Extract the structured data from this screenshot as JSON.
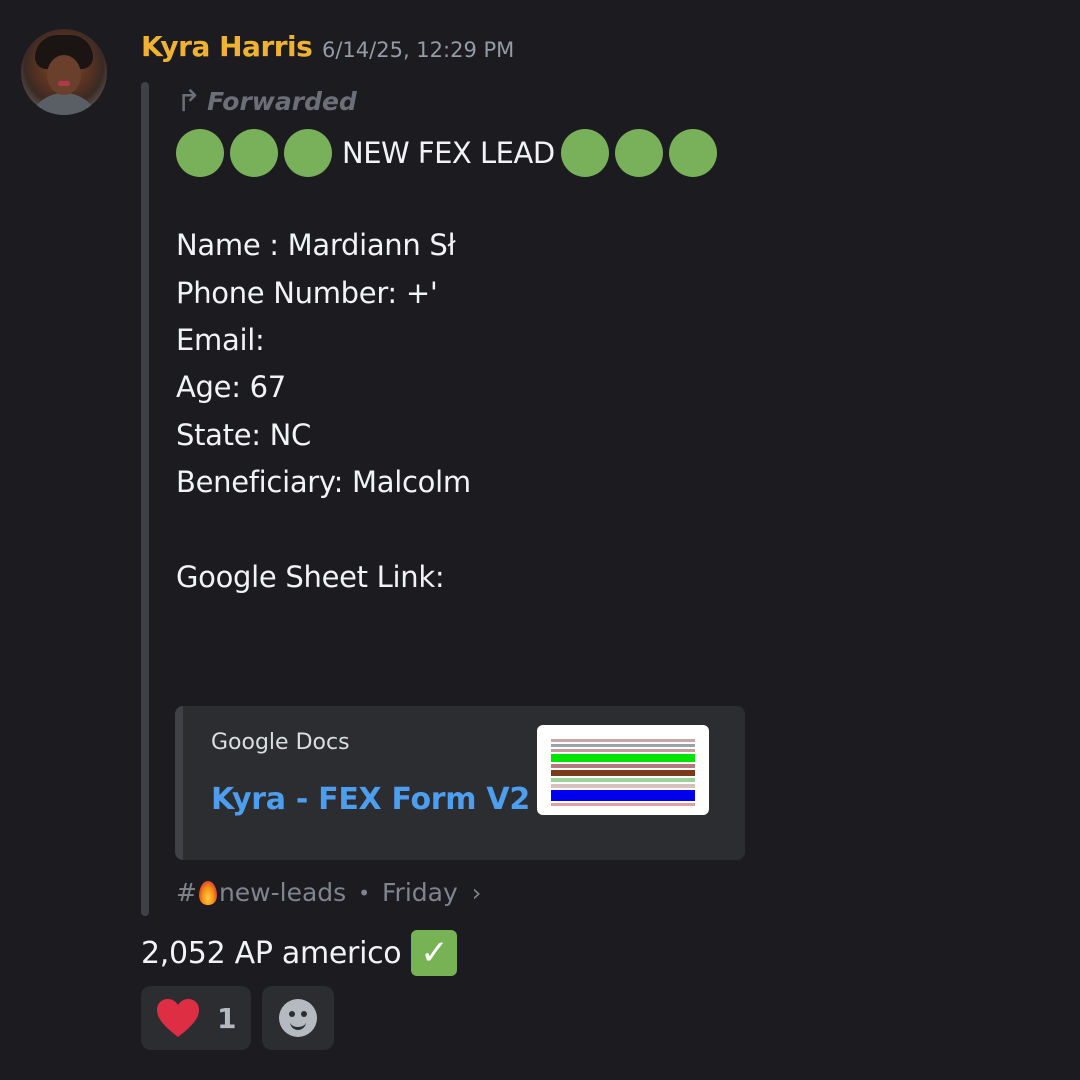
{
  "message": {
    "author": "Kyra Harris",
    "timestamp": "6/14/25, 12:29 PM",
    "forwarded_label": "Forwarded",
    "forwarded_icon": "forward-arrow-icon",
    "headline": "NEW FEX LEAD",
    "headline_emoji": "green-circle-icon",
    "fields": {
      "name": "Name : Mardiann Sł",
      "phone": "Phone Number: +'",
      "email": "Email:",
      "age": "Age: 67",
      "state": "State: NC",
      "beneficiary": "Beneficiary: Malcolm",
      "sheet_link": "Google Sheet Link:"
    },
    "embed": {
      "provider": "Google Docs",
      "title": "Kyra - FEX Form V2"
    },
    "source": {
      "hash": "#",
      "channel": "new-leads",
      "separator": "•",
      "day": "Friday",
      "chevron": "›"
    },
    "reply_text": "2,052 AP americo",
    "reply_emoji": "check-mark-button-icon"
  },
  "reactions": [
    {
      "emoji": "red-heart-icon",
      "count": "1"
    }
  ],
  "add_reaction_icon": "add-reaction-smile-icon",
  "colors": {
    "background": "#1c1c20",
    "username": "#f0b232",
    "link": "#4e9ef0",
    "green_circle": "#78b159",
    "muted": "#949ba4"
  }
}
